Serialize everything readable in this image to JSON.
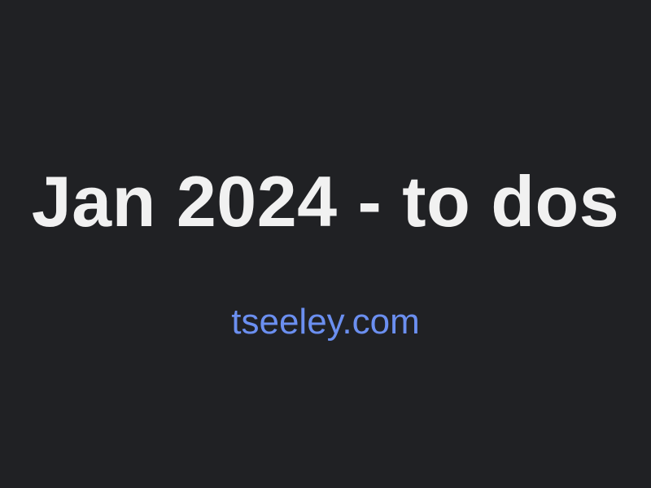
{
  "page": {
    "title": "Jan 2024 - to dos",
    "site_link": "tseeley.com"
  },
  "colors": {
    "background": "#202124",
    "title_text": "#f1f1f1",
    "link_text": "#6b8ff0"
  }
}
